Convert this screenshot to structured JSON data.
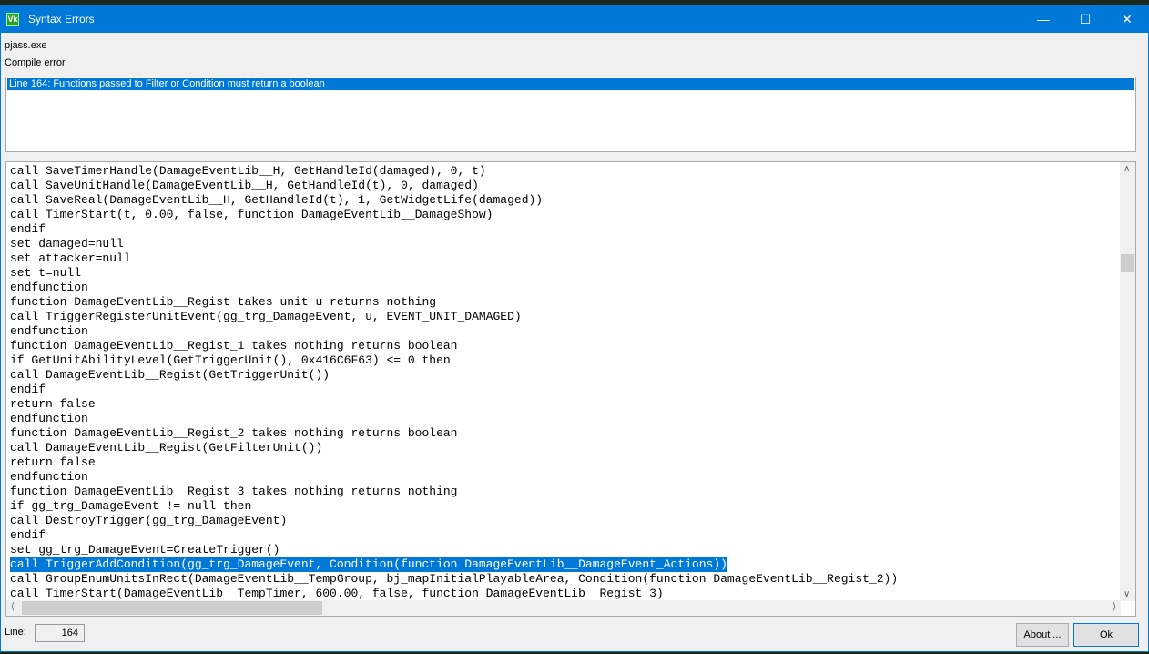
{
  "window": {
    "title": "Syntax Errors",
    "app_icon": "jass-editor-icon"
  },
  "header": {
    "program": "pjass.exe",
    "status": "Compile error."
  },
  "errors": [
    {
      "text": "Line 164:  Functions passed to Filter or Condition must return a boolean",
      "selected": true
    }
  ],
  "code_lines": [
    "call SaveTimerHandle(DamageEventLib__H, GetHandleId(damaged), 0, t)",
    "call SaveUnitHandle(DamageEventLib__H, GetHandleId(t), 0, damaged)",
    "call SaveReal(DamageEventLib__H, GetHandleId(t), 1, GetWidgetLife(damaged))",
    "call TimerStart(t, 0.00, false, function DamageEventLib__DamageShow)",
    "endif",
    "set damaged=null",
    "set attacker=null",
    "set t=null",
    "endfunction",
    "function DamageEventLib__Regist takes unit u returns nothing",
    "call TriggerRegisterUnitEvent(gg_trg_DamageEvent, u, EVENT_UNIT_DAMAGED)",
    "endfunction",
    "function DamageEventLib__Regist_1 takes nothing returns boolean",
    "if GetUnitAbilityLevel(GetTriggerUnit(), 0x416C6F63) <= 0 then",
    "call DamageEventLib__Regist(GetTriggerUnit())",
    "endif",
    "return false",
    "endfunction",
    "function DamageEventLib__Regist_2 takes nothing returns boolean",
    "call DamageEventLib__Regist(GetFilterUnit())",
    "return false",
    "endfunction",
    "function DamageEventLib__Regist_3 takes nothing returns nothing",
    "if gg_trg_DamageEvent != null then",
    "call DestroyTrigger(gg_trg_DamageEvent)",
    "endif",
    "set gg_trg_DamageEvent=CreateTrigger()",
    "call TriggerAddCondition(gg_trg_DamageEvent, Condition(function DamageEventLib__DamageEvent_Actions))",
    "call GroupEnumUnitsInRect(DamageEventLib__TempGroup, bj_mapInitialPlayableArea, Condition(function DamageEventLib__Regist_2))",
    "call TimerStart(DamageEventLib__TempTimer, 600.00, false, function DamageEventLib__Regist_3)"
  ],
  "selected_line_index": 27,
  "footer": {
    "line_label": "Line:",
    "line_value": "164",
    "about_label": "About ...",
    "ok_label": "Ok"
  },
  "colors": {
    "accent": "#0078d7"
  }
}
